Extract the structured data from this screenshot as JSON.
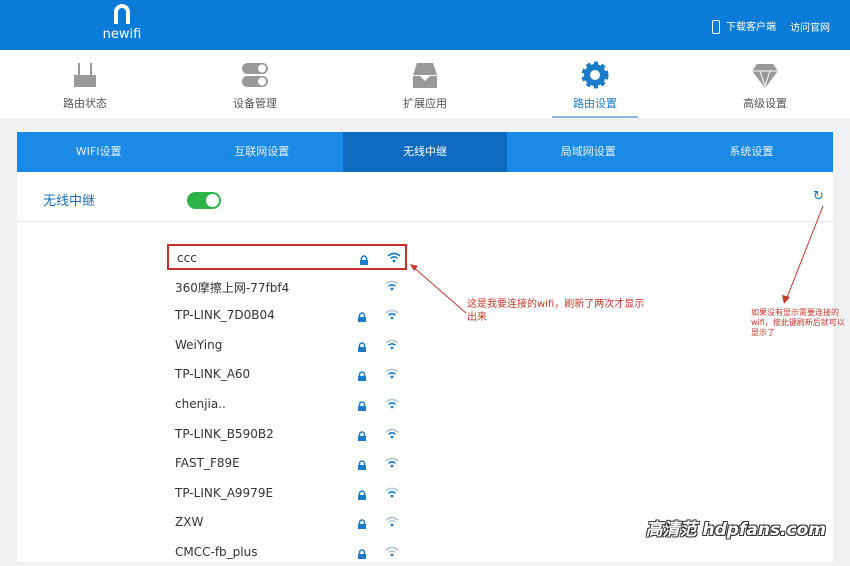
{
  "header": {
    "logo": "newifi",
    "download_client": "下载客户端",
    "visit_site": "访问官网"
  },
  "nav": [
    {
      "label": "路由状态",
      "icon": "router-icon"
    },
    {
      "label": "设备管理",
      "icon": "toggles-icon"
    },
    {
      "label": "扩展应用",
      "icon": "tray-icon"
    },
    {
      "label": "路由设置",
      "icon": "gear-icon",
      "active": true
    },
    {
      "label": "高级设置",
      "icon": "diamond-icon"
    }
  ],
  "tabs": [
    "WIFI设置",
    "互联网设置",
    "无线中继",
    "局域网设置",
    "系统设置"
  ],
  "active_tab": 2,
  "repeater": {
    "label": "无线中继",
    "enabled": true
  },
  "networks": [
    {
      "ssid": "ccc",
      "locked": true,
      "signal": 4,
      "highlighted": true
    },
    {
      "ssid": "360摩擦上网-77fbf4",
      "locked": false,
      "signal": 3
    },
    {
      "ssid": "TP-LINK_7D0B04",
      "locked": true,
      "signal": 3
    },
    {
      "ssid": "WeiYing",
      "locked": true,
      "signal": 3
    },
    {
      "ssid": "TP-LINK_A60",
      "locked": true,
      "signal": 3
    },
    {
      "ssid": "chenjia..",
      "locked": true,
      "signal": 2
    },
    {
      "ssid": "TP-LINK_B590B2",
      "locked": true,
      "signal": 3
    },
    {
      "ssid": "FAST_F89E",
      "locked": true,
      "signal": 3
    },
    {
      "ssid": "TP-LINK_A9979E",
      "locked": true,
      "signal": 3
    },
    {
      "ssid": "ZXW",
      "locked": true,
      "signal": 1
    },
    {
      "ssid": "CMCC-fb_plus",
      "locked": true,
      "signal": 1
    }
  ],
  "annotations": {
    "left": "这是我要连接的wifi，刷新了两次才显示出来",
    "right": "如果没有显示需要连接的wifi，按此键刷新后就可以显示了"
  },
  "watermark": "高清范 hdpfans.com",
  "colors": {
    "header": "#0a7bd6",
    "tab_bar": "#1a8ae6",
    "tab_active": "#0d6cc0",
    "toggle_on": "#2cb34a",
    "annotation": "#c0392b"
  }
}
